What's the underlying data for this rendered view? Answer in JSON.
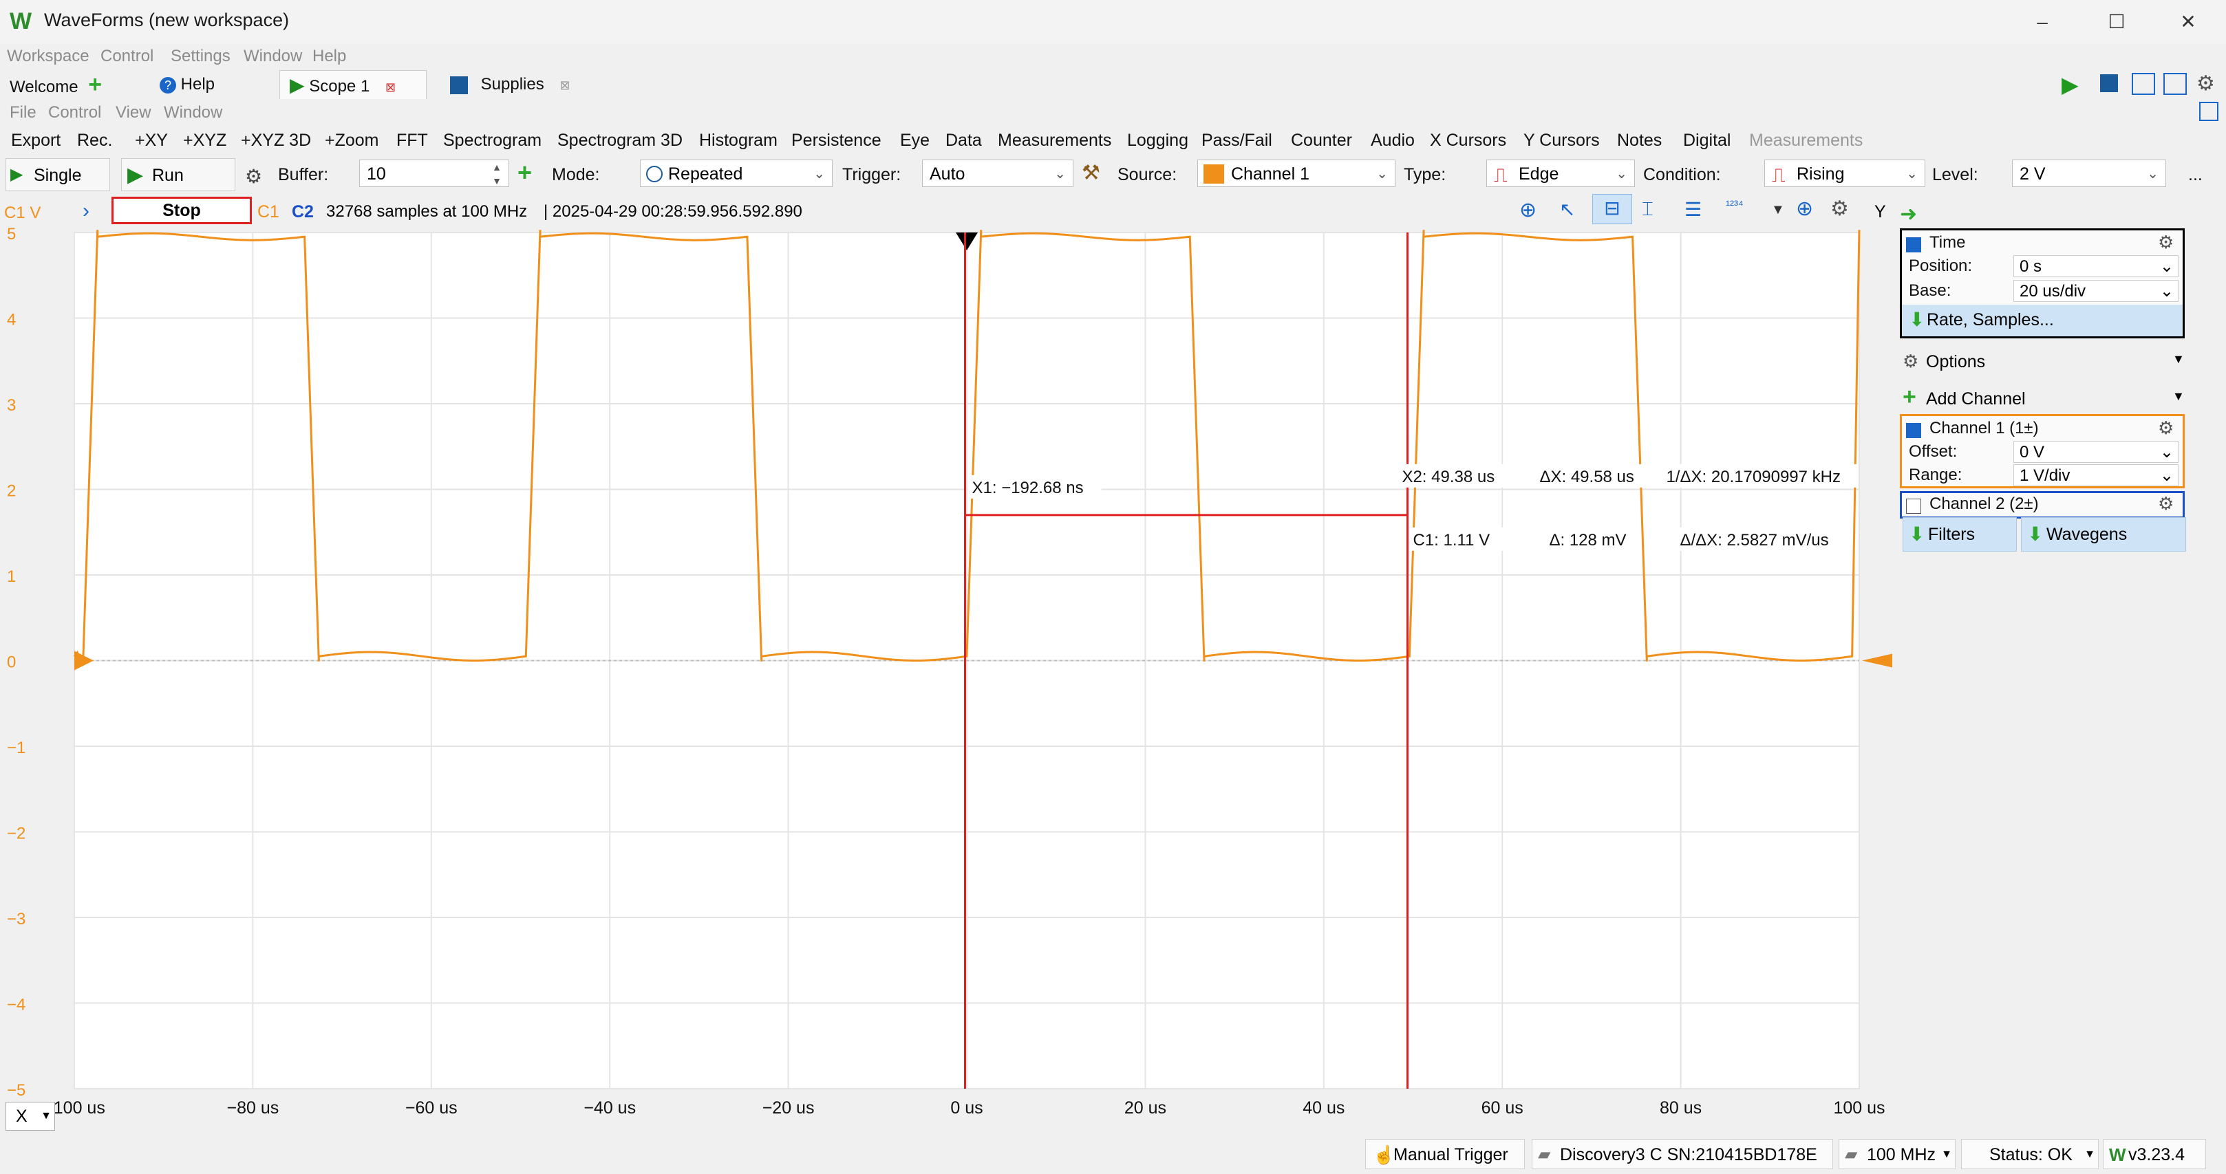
{
  "window": {
    "title": "WaveForms (new workspace)",
    "minimize": "–",
    "maximize": "☐",
    "close": "✕"
  },
  "menu": [
    "Workspace",
    "Control",
    "Settings",
    "Window",
    "Help"
  ],
  "tabs": [
    {
      "label": "Welcome",
      "active": false
    },
    {
      "label": "Help",
      "active": false
    },
    {
      "label": "Scope 1",
      "active": true
    },
    {
      "label": "Supplies",
      "active": false
    }
  ],
  "scope_menu": [
    "File",
    "Control",
    "View",
    "Window"
  ],
  "toolbar_views": [
    "Export",
    "Rec.",
    "+XY",
    "+XYZ",
    "+XYZ 3D",
    "+Zoom",
    "FFT",
    "Spectrogram",
    "Spectrogram 3D",
    "Histogram",
    "Persistence",
    "Eye",
    "Data",
    "Measurements",
    "Logging",
    "Pass/Fail",
    "Counter",
    "Audio",
    "X Cursors",
    "Y Cursors",
    "Notes",
    "Digital",
    "Measurements"
  ],
  "acquire": {
    "single": "Single",
    "run": "Run",
    "buffer_label": "Buffer:",
    "buffer_value": "10",
    "mode_label": "Mode:",
    "mode_value": "Repeated",
    "trigger_label": "Trigger:",
    "trigger_value": "Auto",
    "source_label": "Source:",
    "source_value": "Channel 1",
    "type_label": "Type:",
    "type_value": "Edge",
    "condition_label": "Condition:",
    "condition_value": "Rising",
    "level_label": "Level:",
    "level_value": "2 V",
    "more": "..."
  },
  "status": {
    "channel_unit": "C1 V",
    "stop": "Stop",
    "c1": "C1",
    "c2": "C2",
    "samples": "32768 samples at 100 MHz",
    "timestamp": "| 2025-04-29 00:28:59.956.592.890",
    "y_label": "Y"
  },
  "chart_data": {
    "type": "line",
    "title": "",
    "xlabel": "",
    "ylabel": "C1 V",
    "xlim": [
      -100,
      100
    ],
    "ylim": [
      -5,
      5
    ],
    "x_unit": "us",
    "x_ticks": [
      "−100 us",
      "−80 us",
      "−60 us",
      "−40 us",
      "−20 us",
      "0 us",
      "20 us",
      "40 us",
      "60 us",
      "80 us",
      "100 us"
    ],
    "y_ticks": [
      "5",
      "4",
      "3",
      "2",
      "1",
      "0",
      "−1",
      "−2",
      "−3",
      "−4",
      "−5"
    ],
    "series": [
      {
        "name": "C1",
        "color": "#f0901a",
        "period_us": 49.6,
        "high_v": 4.95,
        "low_v": 0.05,
        "rising_edges_us": [
          -99.0,
          -49.4,
          0.0,
          49.6,
          99.2
        ],
        "falling_edges_us": [
          -74.2,
          -24.6,
          25.0,
          74.6
        ]
      }
    ],
    "cursors": {
      "x1": {
        "value_us": -0.19268,
        "label": "X1: −192.68 ns"
      },
      "x2": {
        "value_us": 49.38,
        "label": "X2: 49.38 us"
      },
      "dx": "ΔX: 49.58 us",
      "inv_dx": "1/ΔX: 20.17090997 kHz",
      "c1": "C1: 1.11 V",
      "dy": "Δ: 128 mV",
      "dy_dx": "Δ/ΔX: 2.5827 mV/us",
      "hline_v": 1.7
    },
    "grid": true
  },
  "x_axis_selector": "X",
  "right_panel": {
    "time": {
      "title": "Time",
      "position_label": "Position:",
      "position_value": "0 s",
      "base_label": "Base:",
      "base_value": "20 us/div",
      "rate_button": "Rate, Samples..."
    },
    "options": "Options",
    "add_channel": "Add Channel",
    "channel1": {
      "title": "Channel 1 (1±)",
      "offset_label": "Offset:",
      "offset_value": "0 V",
      "range_label": "Range:",
      "range_value": "1 V/div"
    },
    "channel2": {
      "title": "Channel 2 (2±)"
    },
    "filters": "Filters",
    "wavegens": "Wavegens"
  },
  "bottom": {
    "manual_trigger": "Manual Trigger",
    "device": "Discovery3 C SN:210415BD178E",
    "clock": "100 MHz",
    "status": "Status: OK",
    "version": "v3.23.4"
  },
  "colors": {
    "c1": "#f0901a",
    "c2": "#1a4fc8",
    "cursor": "#e02020",
    "accent": "#2e8b2e"
  }
}
